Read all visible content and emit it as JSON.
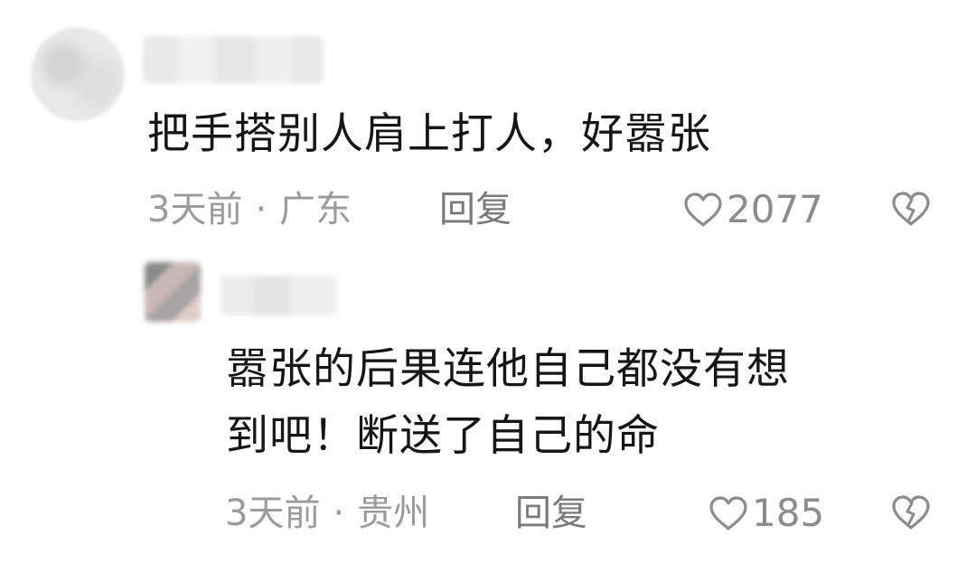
{
  "comment": {
    "text": "把手搭别人肩上打人，好嚣张",
    "time": "3天前",
    "separator": "·",
    "location": "广东",
    "reply_label": "回复",
    "like_count": "2077"
  },
  "reply": {
    "text_line1": "嚣张的后果连他自己都没有想",
    "text_line2": "到吧！断送了自己的命",
    "time": "3天前",
    "separator": "·",
    "location": "贵州",
    "reply_label": "回复",
    "like_count": "185"
  },
  "icons": {
    "like": "heart-outline-icon",
    "dislike": "broken-heart-icon"
  },
  "colors": {
    "text": "#161616",
    "meta": "#9b9b9b",
    "icon": "#8c8c8c"
  }
}
